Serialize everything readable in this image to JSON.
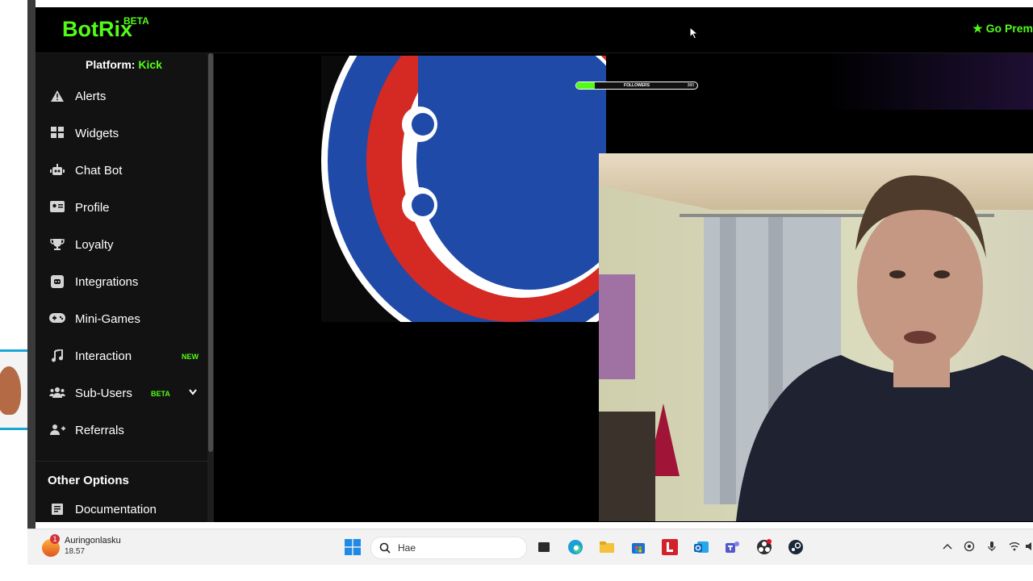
{
  "app": {
    "logo": "BotRix",
    "logo_badge": "BETA",
    "premium_label": "Go Prem",
    "accent": "#53fc18"
  },
  "sidebar": {
    "platform_label": "Platform:",
    "platform_value": "Kick",
    "items": [
      {
        "label": "Alerts",
        "icon": "warning-icon"
      },
      {
        "label": "Widgets",
        "icon": "widgets-grid-icon"
      },
      {
        "label": "Chat Bot",
        "icon": "robot-icon"
      },
      {
        "label": "Profile",
        "icon": "id-card-icon"
      },
      {
        "label": "Loyalty",
        "icon": "trophy-icon"
      },
      {
        "label": "Integrations",
        "icon": "discord-icon"
      },
      {
        "label": "Mini-Games",
        "icon": "gamepad-icon"
      },
      {
        "label": "Interaction",
        "icon": "music-note-icon",
        "badge": "NEW"
      },
      {
        "label": "Sub-Users",
        "icon": "users-icon",
        "badge": "BETA"
      },
      {
        "label": "Referrals",
        "icon": "user-plus-icon"
      }
    ],
    "section_title": "Other Options",
    "other_items": [
      {
        "label": "Documentation",
        "icon": "document-icon"
      }
    ]
  },
  "overlay": {
    "followers_label": "FOLLOWERS",
    "followers_count": "380",
    "followers_progress": 0.15
  },
  "taskbar": {
    "weather_alert_count": "1",
    "weather_title": "Auringonlasku",
    "weather_time": "18.57",
    "search_placeholder": "Hae",
    "apps": [
      "task-view-icon",
      "edge-browser-icon",
      "file-explorer-icon",
      "ms-store-icon",
      "red-l-app-icon",
      "outlook-icon",
      "teams-icon",
      "obs-studio-icon",
      "steam-icon"
    ]
  }
}
